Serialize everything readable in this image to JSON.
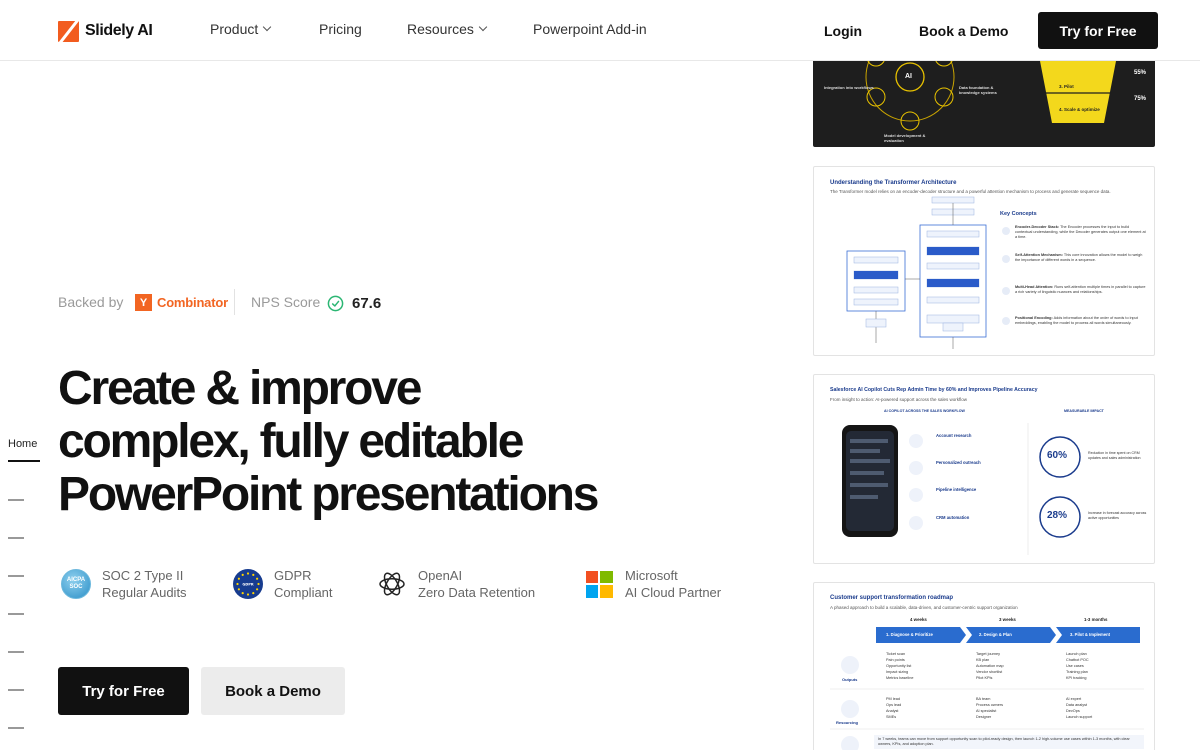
{
  "nav": {
    "brand": "Slidely AI",
    "items": [
      {
        "label": "Product",
        "has_dropdown": true
      },
      {
        "label": "Pricing",
        "has_dropdown": false
      },
      {
        "label": "Resources",
        "has_dropdown": true
      },
      {
        "label": "Powerpoint Add-in",
        "has_dropdown": false
      }
    ],
    "login": "Login",
    "book_demo": "Book a Demo",
    "try_free": "Try for Free"
  },
  "rail": {
    "home": "Home"
  },
  "trust": {
    "backed_by": "Backed by",
    "backer": "Combinator",
    "backer_mark": "Y",
    "nps_label": "NPS Score",
    "nps_value": "67.6"
  },
  "hero": {
    "line1": "Create & improve",
    "line2": "complex, fully editable",
    "line3": "PowerPoint presentations"
  },
  "badges": [
    {
      "title": "SOC 2 Type II",
      "subtitle": "Regular Audits",
      "icon": "aicpa-soc-icon"
    },
    {
      "title": "GDPR",
      "subtitle": "Compliant",
      "icon": "gdpr-icon"
    },
    {
      "title": "OpenAI",
      "subtitle": "Zero Data Retention",
      "icon": "openai-icon"
    },
    {
      "title": "Microsoft",
      "subtitle": "AI Cloud Partner",
      "icon": "microsoft-icon"
    }
  ],
  "cta": {
    "primary": "Try for Free",
    "secondary": "Book a Demo"
  },
  "slides": {
    "funnel": {
      "center": "AI",
      "node_left": "Integration into workflows",
      "node_right": "Data foundation & knowledge systems",
      "node_bottom": "Model development & evaluation",
      "step3": "3. Pilot",
      "step4": "4. Scale & optimize",
      "pct1": "55%",
      "pct2": "75%"
    },
    "transformer": {
      "title": "Understanding the Transformer Architecture",
      "subtitle": "The Transformer model relies on an encoder-decoder structure and a powerful attention mechanism to process and generate sequence data.",
      "key_concepts": "Key Concepts",
      "concepts": [
        {
          "name": "Encoder-Decoder Stack:",
          "text": "The Encoder processes the input to build contextual understanding, while the Decoder generates output one element at a time."
        },
        {
          "name": "Self-Attention Mechanism:",
          "text": "This core innovation allows the model to weigh the importance of different words in a sequence."
        },
        {
          "name": "Multi-Head Attention:",
          "text": "Runs self-attention multiple times in parallel to capture a rich variety of linguistic nuances and relationships."
        },
        {
          "name": "Positional Encoding:",
          "text": "Adds information about the order of words to input embeddings, enabling the model to process all words simultaneously."
        }
      ]
    },
    "copilot": {
      "title": "Salesforce AI Copilot Cuts Rep Admin Time by 60% and Improves Pipeline Accuracy",
      "subtitle": "From insight to action: AI-powered support across the sales workflow",
      "col_left": "AI COPILOT ACROSS THE SALES WORKFLOW",
      "col_right": "MEASURABLE IMPACT",
      "features": [
        "Account research",
        "Personalized outreach",
        "Pipeline intelligence",
        "CRM automation"
      ],
      "stat1": "60%",
      "stat1_text": "Reduction in time spent on CRM updates and sales administration",
      "stat2": "28%",
      "stat2_text": "Increase in forecast accuracy across active opportunities"
    },
    "roadmap": {
      "title": "Customer support transformation roadmap",
      "subtitle": "A phased approach to build a scalable, data-driven, and customer-centric support organization",
      "durations": [
        "4 weeks",
        "3 weeks",
        "1-3 months"
      ],
      "phases": [
        "1. Diagnose & Prioritize",
        "2. Design & Plan",
        "3. Pilot & Implement"
      ],
      "row1_label": "Outputs",
      "row2_label": "Resourcing",
      "outputs": [
        [
          "Ticket scan",
          "Pain points",
          "Opportunity list",
          "Impact sizing",
          "Metrics baseline"
        ],
        [
          "Target journey",
          "KB plan",
          "Automation map",
          "Vendor shortlist",
          "Pilot KPIs"
        ],
        [
          "Launch plan",
          "Chatbot POC",
          "Use cases",
          "Training plan",
          "KPI tracking"
        ]
      ],
      "resourcing": [
        [
          "PM lead",
          "Ops lead",
          "Analyst",
          "SMEs"
        ],
        [
          "BA team",
          "Process owners",
          "AI specialist",
          "Designer"
        ],
        [
          "AI expert",
          "Data analyst",
          "DevOps",
          "Launch support"
        ]
      ],
      "footer": "In 7 weeks, teams can move from support opportunity scan to pilot-ready design, then launch 1-2 high-volume use cases within 1-3 months, with clear owners, KPIs, and adoption plan."
    }
  }
}
